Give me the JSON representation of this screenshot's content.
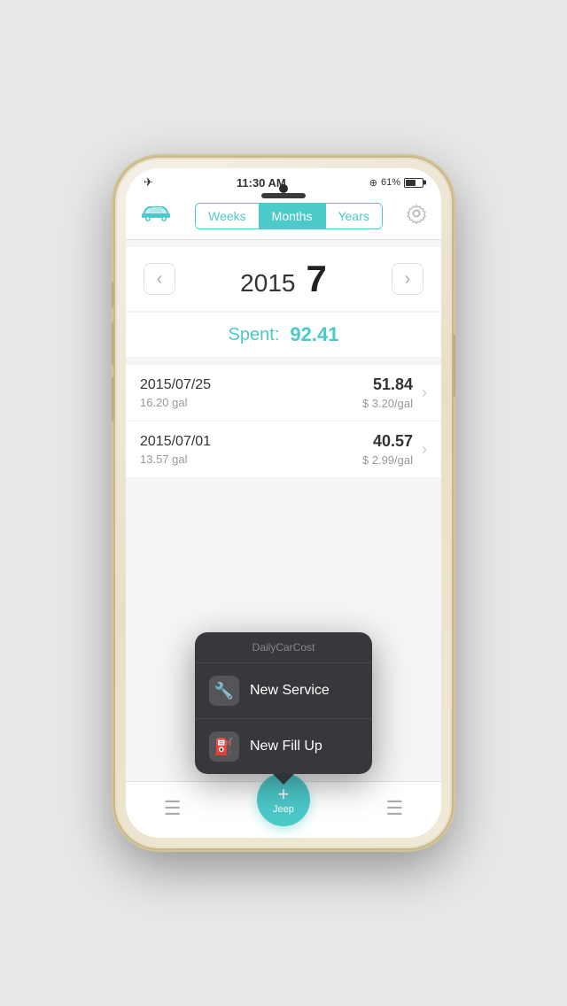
{
  "status_bar": {
    "time": "11:30 AM",
    "battery_percent": "61%",
    "signal": "@"
  },
  "header": {
    "car_icon": "🚗",
    "tabs": [
      {
        "label": "Weeks",
        "active": false
      },
      {
        "label": "Months",
        "active": true
      },
      {
        "label": "Years",
        "active": false
      }
    ],
    "gear_icon": "⚙"
  },
  "navigation": {
    "left_arrow": "‹",
    "right_arrow": "›",
    "year": "2015",
    "month": "7"
  },
  "summary": {
    "spent_label": "Spent:",
    "spent_amount": "92.41"
  },
  "records": [
    {
      "date": "2015/07/25",
      "gallons": "16.20 gal",
      "amount": "51.84",
      "price_per_gal": "$ 3.20/gal"
    },
    {
      "date": "2015/07/01",
      "gallons": "13.57 gal",
      "amount": "40.57",
      "price_per_gal": "$ 2.99/gal"
    }
  ],
  "popup": {
    "title": "DailyCarCost",
    "items": [
      {
        "icon": "🔧",
        "label": "New Service"
      },
      {
        "icon": "⛽",
        "label": "New Fill Up"
      }
    ]
  },
  "bottom_bar": {
    "left_icon": "☰",
    "fab_plus": "+",
    "fab_label": "Jeep",
    "right_icon": "☰"
  }
}
